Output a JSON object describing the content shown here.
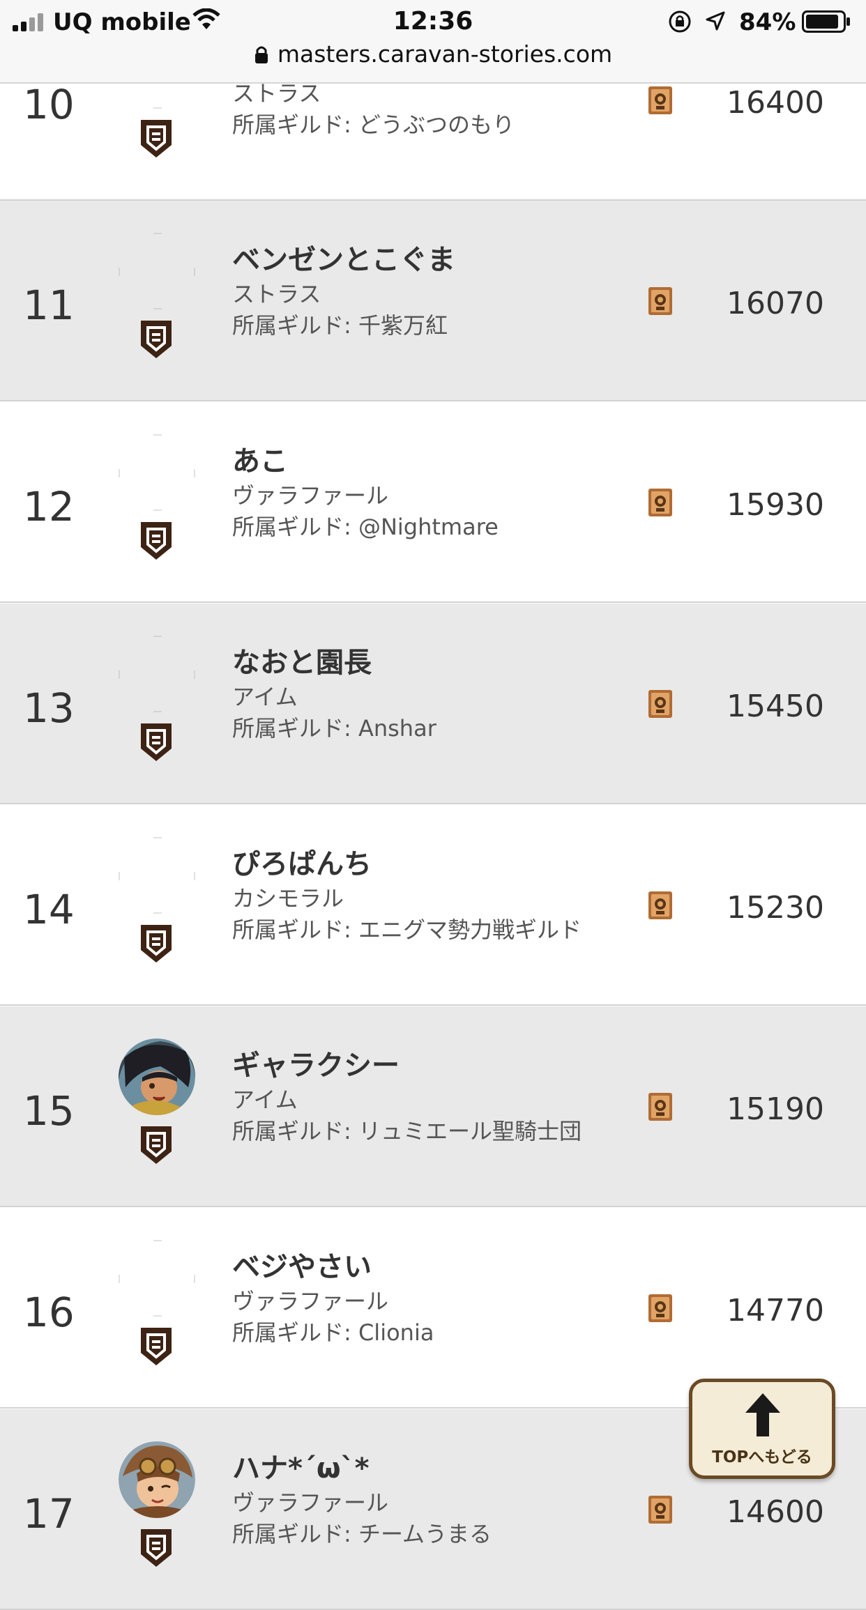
{
  "status_bar": {
    "carrier": "UQ mobile",
    "time": "12:36",
    "battery": "84%"
  },
  "browser": {
    "url": "masters.caravan-stories.com"
  },
  "ranking": [
    {
      "rank": "10",
      "name": "",
      "class": "ストラス",
      "guild": "所属ギルド: どうぶつのもり",
      "score": "16400",
      "avatar": "none"
    },
    {
      "rank": "11",
      "name": "ベンゼンとこぐま",
      "class": "ストラス",
      "guild": "所属ギルド: 千紫万紅",
      "score": "16070",
      "avatar": "none"
    },
    {
      "rank": "12",
      "name": "あこ",
      "class": "ヴァラファール",
      "guild": "所属ギルド: @Nightmare",
      "score": "15930",
      "avatar": "none"
    },
    {
      "rank": "13",
      "name": "なおと園長",
      "class": "アイム",
      "guild": "所属ギルド: Anshar",
      "score": "15450",
      "avatar": "none"
    },
    {
      "rank": "14",
      "name": "ぴろぱんち",
      "class": "カシモラル",
      "guild": "所属ギルド: エニグマ勢力戦ギルド",
      "score": "15230",
      "avatar": "none"
    },
    {
      "rank": "15",
      "name": "ギャラクシー",
      "class": "アイム",
      "guild": "所属ギルド: リュミエール聖騎士団",
      "score": "15190",
      "avatar": "character-portrait-dark"
    },
    {
      "rank": "16",
      "name": "ベジやさい",
      "class": "ヴァラファール",
      "guild": "所属ギルド: Clionia",
      "score": "14770",
      "avatar": "none"
    },
    {
      "rank": "17",
      "name": "ハナ*´ω`*",
      "class": "ヴァラファール",
      "guild": "所属ギルド: チームうまる",
      "score": "14600",
      "avatar": "character-portrait-goggles"
    }
  ],
  "top_button": {
    "label": "TOPへもどる",
    "icon": "arrow-up-icon"
  },
  "icons": {
    "rank_badge": "shield-icon",
    "score_badge": "trophy-icon"
  },
  "colors": {
    "row_alt": "#e9e9e9",
    "shield": "#3d2314",
    "trophy": "#b06c34",
    "button_bg": "#f4ecd6",
    "button_border": "#6b4a26"
  }
}
